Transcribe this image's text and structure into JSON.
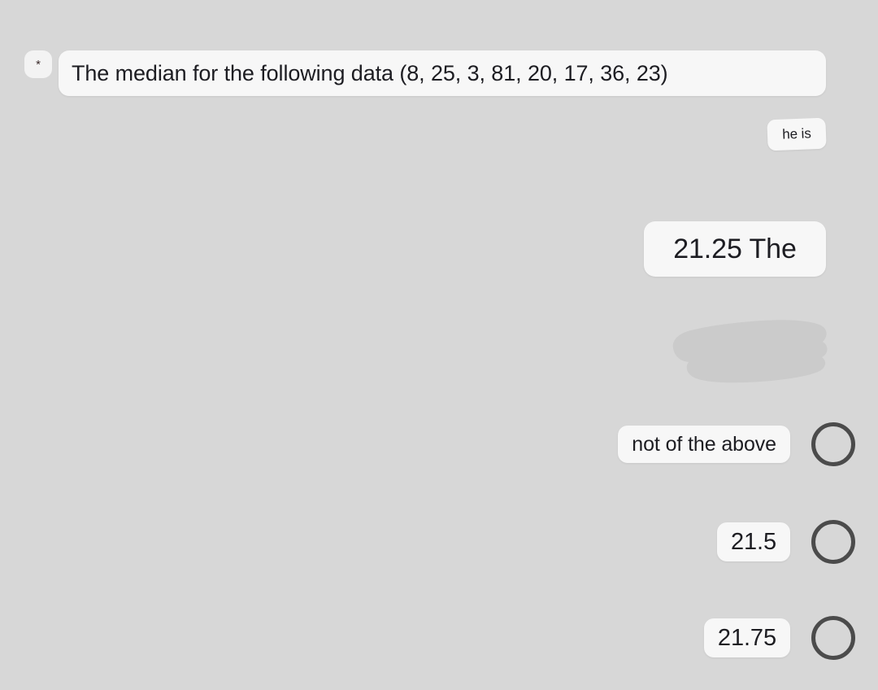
{
  "page": {
    "background_color": "#d7d7d7",
    "bubble_color": "#f7f7f7",
    "text_color": "#1d1d22",
    "radio_color": "#4b4b4b",
    "redaction_color": "#cbcbcb"
  },
  "question": {
    "required_marker": "*",
    "text": "The median for the following data (8, 25, 3, 81, 20, 17, 36, 23)"
  },
  "fragment": {
    "text": "he is"
  },
  "answer": {
    "text": "21.25 The"
  },
  "redaction": {
    "label": "redacted-option"
  },
  "options": [
    {
      "label": "not of the above",
      "selected": false,
      "size": "normal"
    },
    {
      "label": "21.5",
      "selected": false,
      "size": "big"
    },
    {
      "label": "21.75",
      "selected": false,
      "size": "big"
    }
  ]
}
